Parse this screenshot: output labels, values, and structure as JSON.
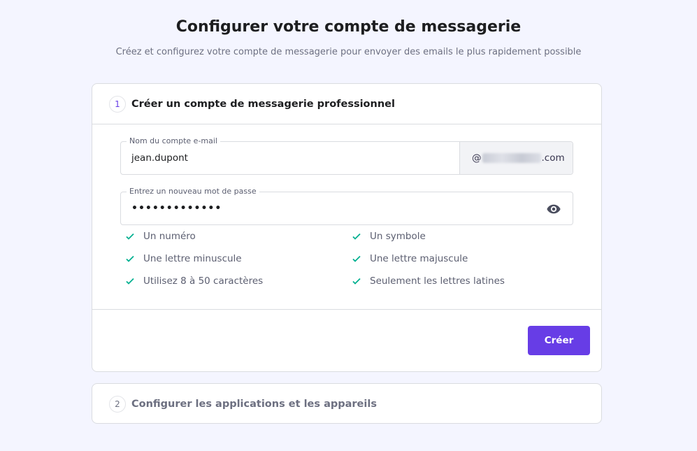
{
  "header": {
    "title": "Configurer votre compte de messagerie",
    "subtitle": "Créez et configurez votre compte de messagerie pour envoyer des emails le plus rapidement possible"
  },
  "step1": {
    "number": "1",
    "title": "Créer un compte de messagerie professionnel",
    "email_field": {
      "label": "Nom du compte e-mail",
      "value": "jean.dupont",
      "domain_prefix": "@",
      "domain_suffix": ".com"
    },
    "password_field": {
      "label": "Entrez un nouveau mot de passe",
      "value": "•••••••••••••"
    },
    "requirements": [
      "Un numéro",
      "Un symbole",
      "Une lettre minuscule",
      "Une lettre majuscule",
      "Utilisez 8 à 50 caractères",
      "Seulement les lettres latines"
    ],
    "create_label": "Créer"
  },
  "step2": {
    "number": "2",
    "title": "Configurer les applications et les appareils"
  },
  "colors": {
    "accent": "#673de6",
    "check": "#00b090",
    "background": "#f4f5ff"
  }
}
